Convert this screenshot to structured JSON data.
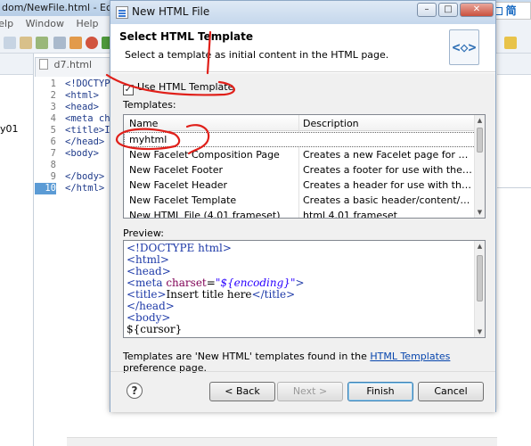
{
  "eclipse": {
    "title": "dom/NewFile.html - Eclips",
    "menu": [
      "Help",
      "Window",
      "Help"
    ],
    "left_panel_text": "y01",
    "editor_tab": "d7.html",
    "code_lines": [
      {
        "num": "1",
        "code": "<!DOCTYP"
      },
      {
        "num": "2",
        "code": "<html>"
      },
      {
        "num": "3",
        "code": "<head>"
      },
      {
        "num": "4",
        "code": "<meta ch"
      },
      {
        "num": "5",
        "code": "<title>I"
      },
      {
        "num": "6",
        "code": "</head>"
      },
      {
        "num": "7",
        "code": "<body>"
      },
      {
        "num": "8",
        "code": ""
      },
      {
        "num": "9",
        "code": "</body>"
      },
      {
        "num": "10",
        "code": "</html>"
      }
    ],
    "notification_count": "62",
    "ime": {
      "logo": "S",
      "zh": "中",
      "jian": "简"
    }
  },
  "dialog": {
    "title": "New HTML File",
    "header_title": "Select HTML Template",
    "header_desc": "Select a template as initial content in the HTML page.",
    "header_icon": "<◇>",
    "checkbox_label": "Use HTML Template",
    "checkbox_checked": true,
    "templates_label": "Templates:",
    "columns": {
      "name": "Name",
      "description": "Description"
    },
    "templates": [
      {
        "name": "myhtml",
        "description": ""
      },
      {
        "name": "New Facelet Composition Page",
        "description": "Creates a new Facelet page for use ..."
      },
      {
        "name": "New Facelet Footer",
        "description": "Creates a footer for use with the Fac..."
      },
      {
        "name": "New Facelet Header",
        "description": "Creates a header for use with the Fa..."
      },
      {
        "name": "New Facelet Template",
        "description": "Creates a basic header/content/foot..."
      },
      {
        "name": "New HTML File (4.01 frameset)",
        "description": "html 4.01 frameset"
      }
    ],
    "preview_label": "Preview:",
    "preview": {
      "l1": "<!DOCTYPE html>",
      "l2": "<html>",
      "l3": "<head>",
      "l4_tag": "<meta ",
      "l4_attr": "charset",
      "l4_eq": "=",
      "l4_val": "\"${encoding}\"",
      "l4_end": ">",
      "l5_open": "<title>",
      "l5_text": "Insert title here",
      "l5_close": "</title>",
      "l6": "</head>",
      "l7": "<body>",
      "l8": "${cursor}"
    },
    "footer_before": "Templates are 'New HTML' templates found in the ",
    "footer_link": "HTML Templates",
    "footer_after": " preference page.",
    "buttons": {
      "help": "?",
      "back": "< Back",
      "next": "Next >",
      "finish": "Finish",
      "cancel": "Cancel"
    }
  },
  "colors": {
    "annotation": "#e0201a",
    "link": "#0645ad",
    "selection_title": "#c5d7ec"
  }
}
